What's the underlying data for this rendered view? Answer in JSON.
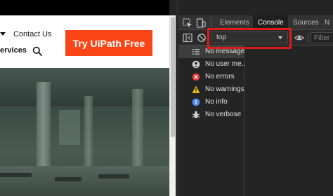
{
  "website": {
    "nav": {
      "contact_label": "Contact Us",
      "services_label": "ervices"
    },
    "cta_label": "Try UiPath Free",
    "accent_color": "#fa4616"
  },
  "devtools": {
    "tabs": [
      {
        "label": "Elements",
        "active": false
      },
      {
        "label": "Console",
        "active": true
      },
      {
        "label": "Sources",
        "active": false
      },
      {
        "label": "N",
        "active": false
      }
    ],
    "toolbar": {
      "context_value": "top",
      "filter_placeholder": "Filter"
    },
    "sidebar": {
      "items": [
        {
          "icon": "list-icon",
          "label": "No messages",
          "selected": true
        },
        {
          "icon": "user-icon",
          "label": "No user me...",
          "selected": false
        },
        {
          "icon": "error-icon",
          "label": "No errors",
          "selected": false
        },
        {
          "icon": "warning-icon",
          "label": "No warnings",
          "selected": false
        },
        {
          "icon": "info-icon",
          "label": "No info",
          "selected": false
        },
        {
          "icon": "verbose-icon",
          "label": "No verbose",
          "selected": false
        }
      ]
    },
    "colors": {
      "error": "#e53935",
      "warning": "#f4c20d",
      "info": "#4c8bf5",
      "highlight": "#e11b1b"
    }
  }
}
